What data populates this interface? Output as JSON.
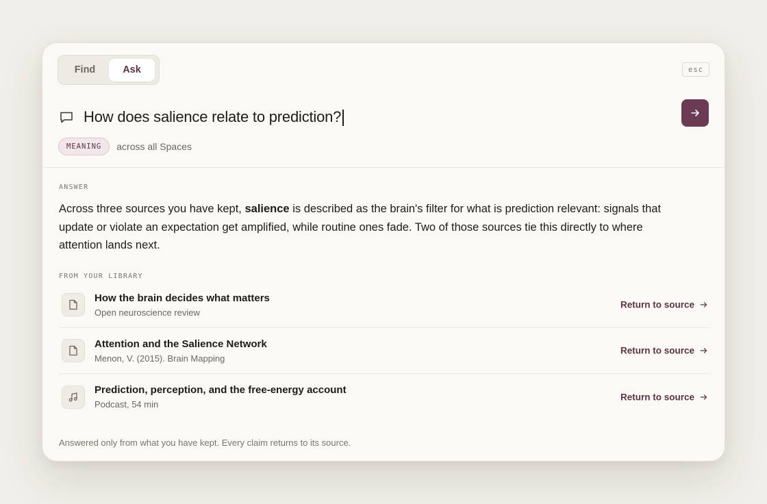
{
  "mode_toggle": {
    "find_label": "Find",
    "ask_label": "Ask",
    "active": "Ask"
  },
  "esc_label": "esc",
  "query": {
    "value": "How does salience relate to prediction?",
    "icon": "chat-bubble-icon"
  },
  "submit": {
    "icon": "arrow-right-icon"
  },
  "scope": {
    "chip_label": "MEANING",
    "text": "across all Spaces"
  },
  "answer": {
    "label": "ANSWER",
    "text_before": "Across three sources you have kept, ",
    "bold_term": "salience",
    "text_after": " is described as the brain's filter for what is prediction relevant: signals that update or violate an expectation get amplified, while routine ones fade. Two of those sources tie this directly to where attention lands next."
  },
  "library": {
    "label": "FROM YOUR LIBRARY",
    "items": [
      {
        "title": "How the brain decides what matters",
        "subtitle": "Open neuroscience review",
        "icon": "document-icon",
        "action": "Return to source"
      },
      {
        "title": "Attention and the Salience Network",
        "subtitle": "Menon, V. (2015). Brain Mapping",
        "icon": "document-icon",
        "action": "Return to source"
      },
      {
        "title": "Prediction, perception, and the free-energy account",
        "subtitle": "Podcast, 54 min",
        "icon": "music-note-icon",
        "action": "Return to source"
      }
    ]
  },
  "footer": "Answered only from what you have kept. Every claim returns to its source.",
  "colors": {
    "accent": "#6b3a53",
    "background": "#f1efe9",
    "panel": "#fbf9f5"
  }
}
